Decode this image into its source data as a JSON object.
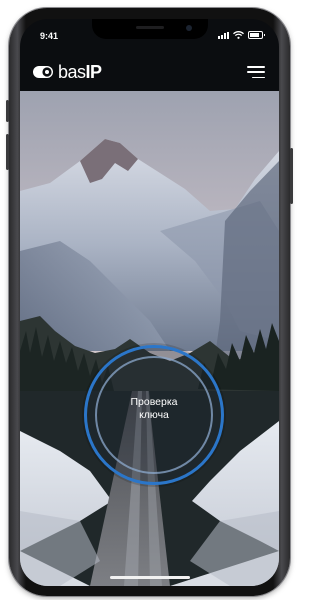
{
  "status_bar": {
    "time": "9:41"
  },
  "header": {
    "brand_prefix": "bas",
    "brand_suffix": "IP",
    "menu_icon": "hamburger-menu-icon"
  },
  "scan_button": {
    "line1": "Проверка",
    "line2": "ключа",
    "ring_color": "#2b76c9"
  },
  "colors": {
    "background": "#0b0d10",
    "accent": "#2b76c9",
    "text": "#ffffff"
  }
}
